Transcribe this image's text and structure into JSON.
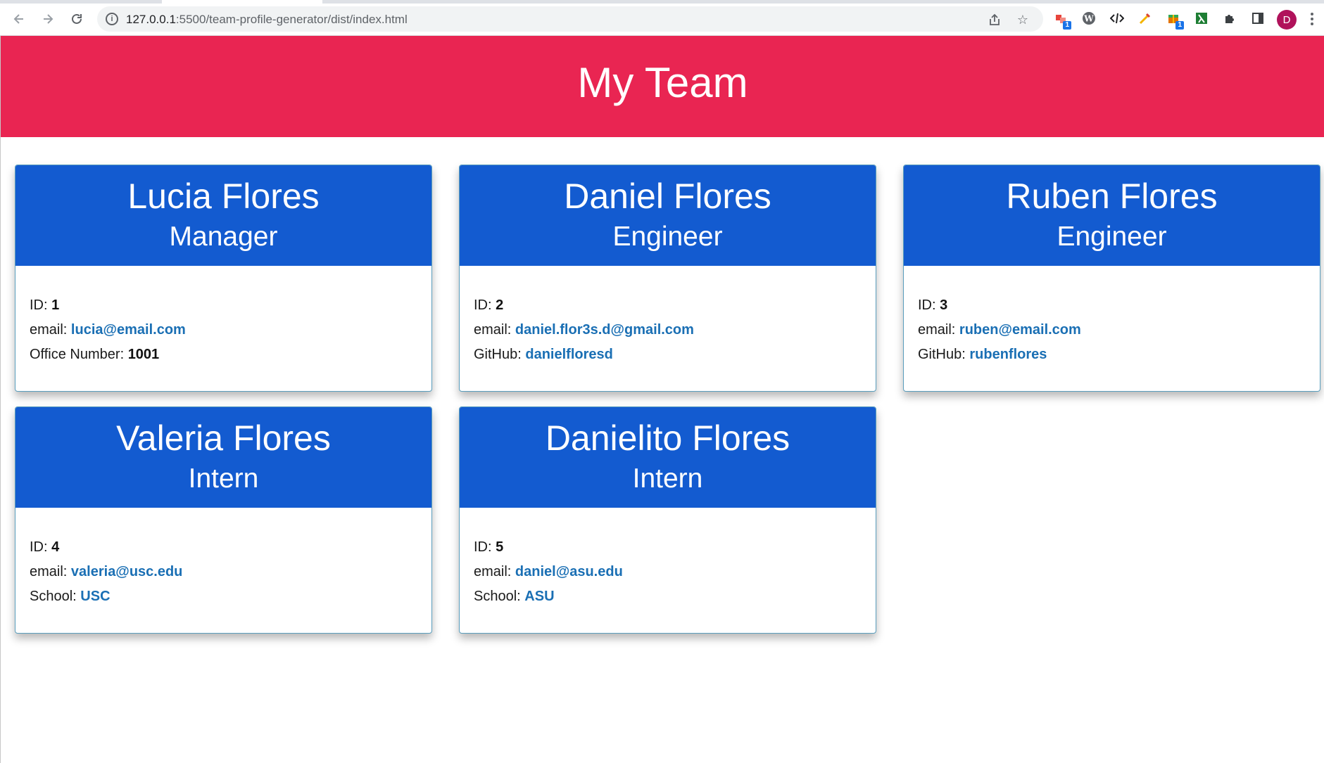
{
  "browser": {
    "url_host": "127.0.0.1",
    "url_path": ":5500/team-profile-generator/dist/index.html",
    "profile_initial": "D",
    "extension_badges": [
      "1",
      "1"
    ]
  },
  "page": {
    "title": "My Team"
  },
  "employees": [
    {
      "name": "Lucia Flores",
      "role": "Manager",
      "id_label": "ID:",
      "id": "1",
      "email_label": "email:",
      "email": "lucia@email.com",
      "extra_label": "Office Number:",
      "extra_value": "1001"
    },
    {
      "name": "Daniel Flores",
      "role": "Engineer",
      "id_label": "ID:",
      "id": "2",
      "email_label": "email:",
      "email": "daniel.flor3s.d@gmail.com",
      "extra_label": "GitHub:",
      "extra_value": "danielfloresd"
    },
    {
      "name": "Ruben Flores",
      "role": "Engineer",
      "id_label": "ID:",
      "id": "3",
      "email_label": "email:",
      "email": "ruben@email.com",
      "extra_label": "GitHub:",
      "extra_value": "rubenflores"
    },
    {
      "name": "Valeria Flores",
      "role": "Intern",
      "id_label": "ID:",
      "id": "4",
      "email_label": "email:",
      "email": "valeria@usc.edu",
      "extra_label": "School:",
      "extra_value": "USC"
    },
    {
      "name": "Danielito Flores",
      "role": "Intern",
      "id_label": "ID:",
      "id": "5",
      "email_label": "email:",
      "email": "daniel@asu.edu",
      "extra_label": "School:",
      "extra_value": "ASU"
    }
  ],
  "colors": {
    "header_bg": "#e92552",
    "card_header_bg": "#135bd0",
    "link": "#1a6fb4"
  }
}
